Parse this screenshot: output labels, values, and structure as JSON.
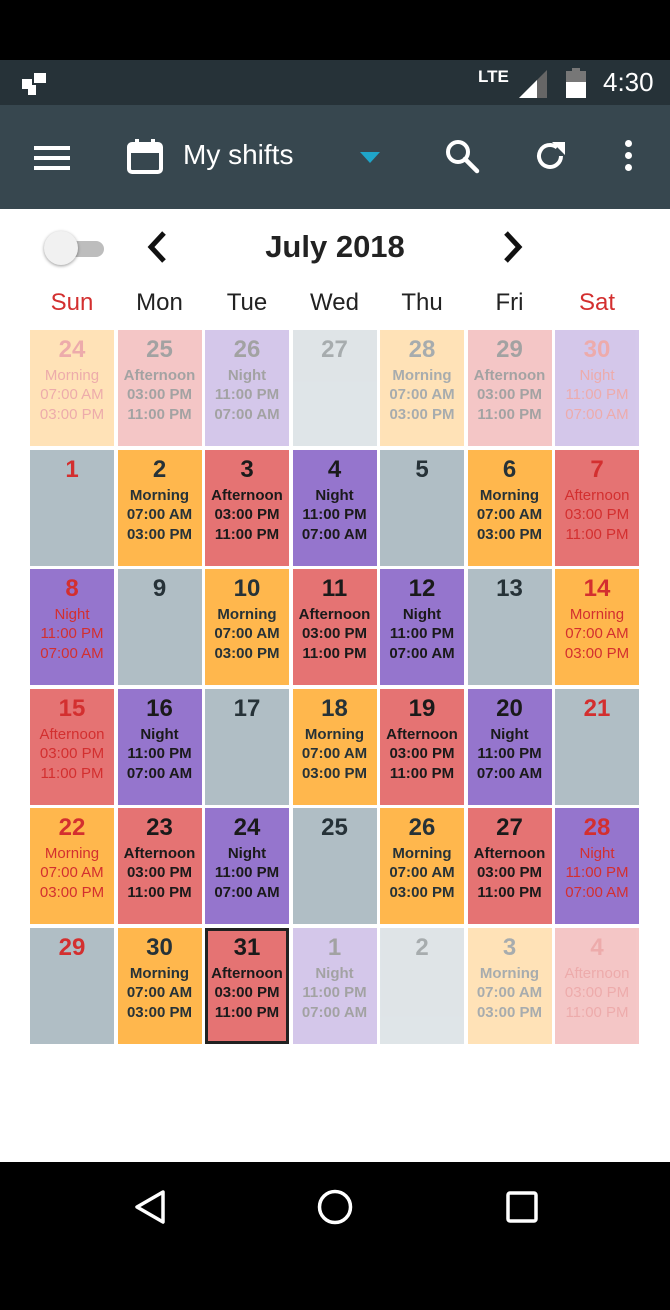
{
  "status_bar": {
    "network": "LTE",
    "time": "4:30"
  },
  "toolbar": {
    "title": "My shifts",
    "icons": [
      "menu-icon",
      "calendar-icon",
      "dropdown-icon",
      "search-icon",
      "refresh-icon",
      "more-icon"
    ],
    "dropdown_color": "#1fa5c9"
  },
  "calendar": {
    "month_title": "July 2018",
    "weekdays": [
      "Sun",
      "Mon",
      "Tue",
      "Wed",
      "Thu",
      "Fri",
      "Sat"
    ],
    "colors": {
      "morning": "#ffb74d",
      "afternoon": "#e57373",
      "night": "#9575cd",
      "off": "#b0bec5",
      "weekend_text": "#d32f2f"
    },
    "weeks": [
      [
        {
          "day": "24",
          "shift": "Morning",
          "start": "07:00 AM",
          "end": "03:00 PM",
          "type": "morning",
          "faded": true
        },
        {
          "day": "25",
          "shift": "Afternoon",
          "start": "03:00 PM",
          "end": "11:00 PM",
          "type": "afternoon",
          "faded": true
        },
        {
          "day": "26",
          "shift": "Night",
          "start": "11:00 PM",
          "end": "07:00 AM",
          "type": "night",
          "faded": true
        },
        {
          "day": "27",
          "shift": "",
          "start": "",
          "end": "",
          "type": "off",
          "faded": true
        },
        {
          "day": "28",
          "shift": "Morning",
          "start": "07:00 AM",
          "end": "03:00 PM",
          "type": "morning",
          "faded": true
        },
        {
          "day": "29",
          "shift": "Afternoon",
          "start": "03:00 PM",
          "end": "11:00 PM",
          "type": "afternoon",
          "faded": true
        },
        {
          "day": "30",
          "shift": "Night",
          "start": "11:00 PM",
          "end": "07:00 AM",
          "type": "night",
          "faded": true
        }
      ],
      [
        {
          "day": "1",
          "shift": "",
          "start": "",
          "end": "",
          "type": "off"
        },
        {
          "day": "2",
          "shift": "Morning",
          "start": "07:00 AM",
          "end": "03:00 PM",
          "type": "morning"
        },
        {
          "day": "3",
          "shift": "Afternoon",
          "start": "03:00 PM",
          "end": "11:00 PM",
          "type": "afternoon"
        },
        {
          "day": "4",
          "shift": "Night",
          "start": "11:00 PM",
          "end": "07:00 AM",
          "type": "night"
        },
        {
          "day": "5",
          "shift": "",
          "start": "",
          "end": "",
          "type": "off"
        },
        {
          "day": "6",
          "shift": "Morning",
          "start": "07:00 AM",
          "end": "03:00 PM",
          "type": "morning"
        },
        {
          "day": "7",
          "shift": "Afternoon",
          "start": "03:00 PM",
          "end": "11:00 PM",
          "type": "afternoon"
        }
      ],
      [
        {
          "day": "8",
          "shift": "Night",
          "start": "11:00 PM",
          "end": "07:00 AM",
          "type": "night"
        },
        {
          "day": "9",
          "shift": "",
          "start": "",
          "end": "",
          "type": "off"
        },
        {
          "day": "10",
          "shift": "Morning",
          "start": "07:00 AM",
          "end": "03:00 PM",
          "type": "morning"
        },
        {
          "day": "11",
          "shift": "Afternoon",
          "start": "03:00 PM",
          "end": "11:00 PM",
          "type": "afternoon"
        },
        {
          "day": "12",
          "shift": "Night",
          "start": "11:00 PM",
          "end": "07:00 AM",
          "type": "night"
        },
        {
          "day": "13",
          "shift": "",
          "start": "",
          "end": "",
          "type": "off"
        },
        {
          "day": "14",
          "shift": "Morning",
          "start": "07:00 AM",
          "end": "03:00 PM",
          "type": "morning"
        }
      ],
      [
        {
          "day": "15",
          "shift": "Afternoon",
          "start": "03:00 PM",
          "end": "11:00 PM",
          "type": "afternoon"
        },
        {
          "day": "16",
          "shift": "Night",
          "start": "11:00 PM",
          "end": "07:00 AM",
          "type": "night"
        },
        {
          "day": "17",
          "shift": "",
          "start": "",
          "end": "",
          "type": "off"
        },
        {
          "day": "18",
          "shift": "Morning",
          "start": "07:00 AM",
          "end": "03:00 PM",
          "type": "morning"
        },
        {
          "day": "19",
          "shift": "Afternoon",
          "start": "03:00 PM",
          "end": "11:00 PM",
          "type": "afternoon"
        },
        {
          "day": "20",
          "shift": "Night",
          "start": "11:00 PM",
          "end": "07:00 AM",
          "type": "night"
        },
        {
          "day": "21",
          "shift": "",
          "start": "",
          "end": "",
          "type": "off"
        }
      ],
      [
        {
          "day": "22",
          "shift": "Morning",
          "start": "07:00 AM",
          "end": "03:00 PM",
          "type": "morning"
        },
        {
          "day": "23",
          "shift": "Afternoon",
          "start": "03:00 PM",
          "end": "11:00 PM",
          "type": "afternoon"
        },
        {
          "day": "24",
          "shift": "Night",
          "start": "11:00 PM",
          "end": "07:00 AM",
          "type": "night"
        },
        {
          "day": "25",
          "shift": "",
          "start": "",
          "end": "",
          "type": "off"
        },
        {
          "day": "26",
          "shift": "Morning",
          "start": "07:00 AM",
          "end": "03:00 PM",
          "type": "morning"
        },
        {
          "day": "27",
          "shift": "Afternoon",
          "start": "03:00 PM",
          "end": "11:00 PM",
          "type": "afternoon"
        },
        {
          "day": "28",
          "shift": "Night",
          "start": "11:00 PM",
          "end": "07:00 AM",
          "type": "night"
        }
      ],
      [
        {
          "day": "29",
          "shift": "",
          "start": "",
          "end": "",
          "type": "off"
        },
        {
          "day": "30",
          "shift": "Morning",
          "start": "07:00 AM",
          "end": "03:00 PM",
          "type": "morning"
        },
        {
          "day": "31",
          "shift": "Afternoon",
          "start": "03:00 PM",
          "end": "11:00 PM",
          "type": "afternoon",
          "today": true
        },
        {
          "day": "1",
          "shift": "Night",
          "start": "11:00 PM",
          "end": "07:00 AM",
          "type": "night",
          "faded": true
        },
        {
          "day": "2",
          "shift": "",
          "start": "",
          "end": "",
          "type": "off",
          "faded": true
        },
        {
          "day": "3",
          "shift": "Morning",
          "start": "07:00 AM",
          "end": "03:00 PM",
          "type": "morning",
          "faded": true
        },
        {
          "day": "4",
          "shift": "Afternoon",
          "start": "03:00 PM",
          "end": "11:00 PM",
          "type": "afternoon",
          "faded": true
        }
      ]
    ]
  },
  "nav_bar": {
    "icons": [
      "back-icon",
      "home-icon",
      "recents-icon"
    ]
  }
}
